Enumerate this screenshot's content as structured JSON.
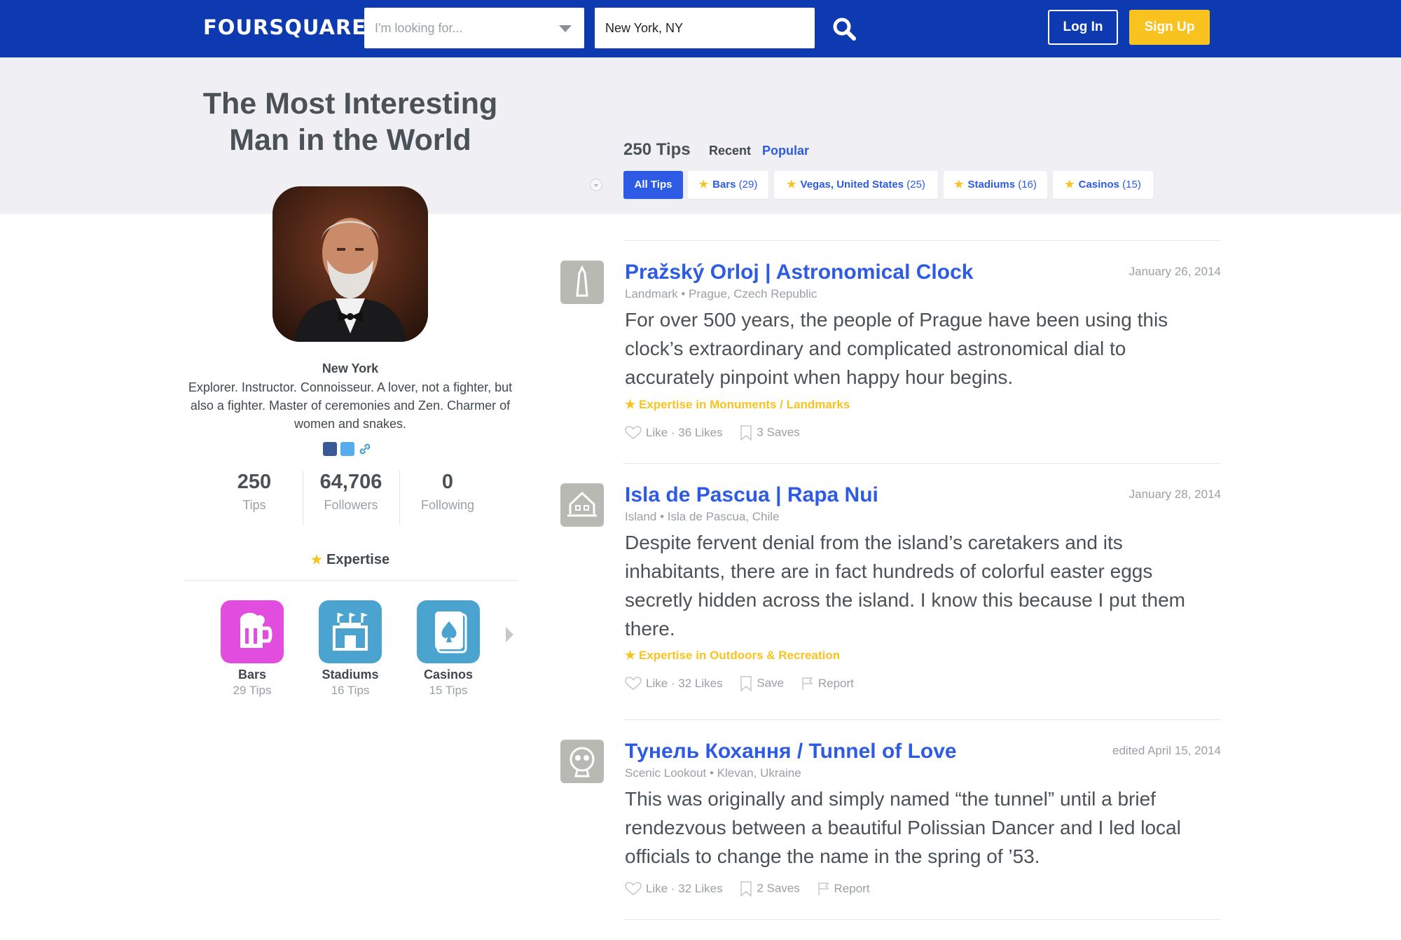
{
  "header": {
    "logo": "FOURSQUARE",
    "search_placeholder": "I'm looking for...",
    "location_value": "New York, NY",
    "login_label": "Log In",
    "signup_label": "Sign Up",
    "brand_color": "#0d3ab0",
    "accent_color": "#f9c31f"
  },
  "profile": {
    "name_line1": "The Most Interesting",
    "name_line2": "Man in the World",
    "hometown": "New York",
    "bio": "Explorer. Instructor. Connoisseur. A lover, not a fighter, but also a fighter. Master of ceremonies and Zen. Charmer of women and snakes.",
    "social_icons": [
      "facebook-icon",
      "twitter-icon",
      "link-icon"
    ],
    "stats": [
      {
        "value": "250",
        "label": "Tips"
      },
      {
        "value": "64,706",
        "label": "Followers"
      },
      {
        "value": "0",
        "label": "Following"
      }
    ],
    "expertise_heading": "Expertise",
    "expertise": [
      {
        "title": "Bars",
        "sub": "29 Tips",
        "icon": "beer-mug-icon",
        "color": "#e24de0"
      },
      {
        "title": "Stadiums",
        "sub": "16 Tips",
        "icon": "stadium-icon",
        "color": "#4ba3cf"
      },
      {
        "title": "Casinos",
        "sub": "15 Tips",
        "icon": "playing-card-icon",
        "color": "#4ba3cf"
      }
    ]
  },
  "tips_header": {
    "count_label": "250 Tips",
    "sort_recent": "Recent",
    "sort_popular": "Popular",
    "filters": [
      {
        "label": "All Tips",
        "count": "",
        "active": true
      },
      {
        "label": "Bars",
        "count": "(29)",
        "active": false
      },
      {
        "label": "Vegas, United States",
        "count": "(25)",
        "active": false
      },
      {
        "label": "Stadiums",
        "count": "(16)",
        "active": false
      },
      {
        "label": "Casinos",
        "count": "(15)",
        "active": false
      }
    ]
  },
  "tips": [
    {
      "title": "Pražský Orloj | Astronomical Clock",
      "date": "January 26, 2014",
      "category": "Landmark",
      "location": "Prague, Czech Republic",
      "body": "For over 500 years, the people of Prague have been using this clock’s extraordinary and complicated astronomical dial to accurately pinpoint when happy hour begins.",
      "expertise": "Expertise in Monuments / Landmarks",
      "like": "Like · 36 Likes",
      "save": "3 Saves",
      "report": "",
      "icon": "monument-icon"
    },
    {
      "title": "Isla de Pascua | Rapa Nui",
      "date": "January 28, 2014",
      "category": "Island",
      "location": "Isla de Pascua, Chile",
      "body": "Despite fervent denial from the island’s caretakers and its inhabitants, there are in fact hundreds of colorful easter eggs secretly hidden across the island. I know this because I put them there.",
      "expertise": "Expertise in Outdoors & Recreation",
      "like": "Like · 32 Likes",
      "save": "Save",
      "report": "Report",
      "icon": "island-icon"
    },
    {
      "title": "Тунель Кохання / Tunnel of Love",
      "date": "edited April 15, 2014",
      "category": "Scenic Lookout",
      "location": "Klevan, Ukraine",
      "body": "This was originally and simply named “the tunnel” until a brief rendezvous between a beautiful Polissian Dancer and I led local officials to change the name in the spring of ’53.",
      "expertise": "",
      "like": "Like · 32 Likes",
      "save": "2 Saves",
      "report": "Report",
      "icon": "viewer-icon"
    }
  ]
}
